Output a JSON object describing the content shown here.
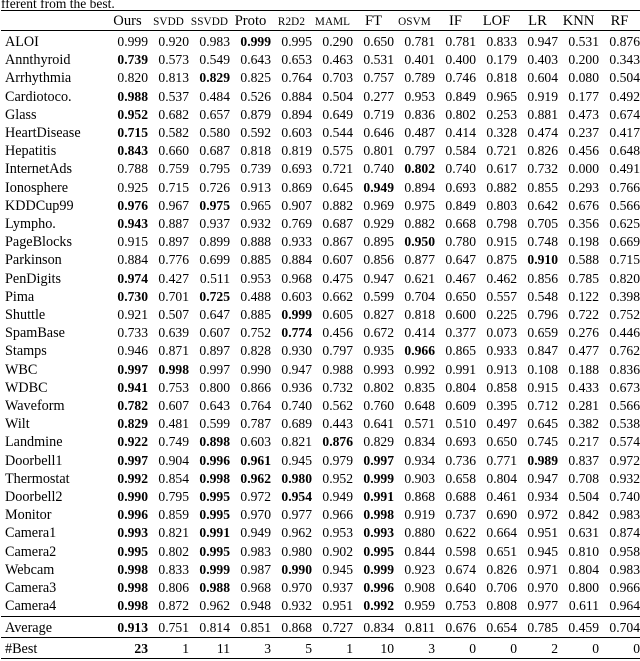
{
  "caption_tail": "fferent from the best.",
  "table": {
    "row_header_label": "",
    "columns": [
      "Ours",
      "SVDD",
      "SSVDD",
      "Proto",
      "R2D2",
      "MAML",
      "FT",
      "OSVM",
      "IF",
      "LOF",
      "LR",
      "KNN",
      "RF"
    ],
    "column_styles": [
      "reg",
      "sc",
      "sc",
      "reg",
      "sc",
      "sc",
      "reg",
      "sc",
      "reg",
      "reg",
      "reg",
      "reg",
      "reg"
    ],
    "rows": [
      {
        "name": "ALOI",
        "values": [
          "0.999",
          "0.920",
          "0.983",
          "0.999",
          "0.995",
          "0.290",
          "0.650",
          "0.781",
          "0.781",
          "0.833",
          "0.947",
          "0.531",
          "0.876"
        ],
        "bold": [
          3
        ]
      },
      {
        "name": "Annthyroid",
        "values": [
          "0.739",
          "0.573",
          "0.549",
          "0.643",
          "0.653",
          "0.463",
          "0.531",
          "0.401",
          "0.400",
          "0.179",
          "0.403",
          "0.200",
          "0.343"
        ],
        "bold": [
          0
        ]
      },
      {
        "name": "Arrhythmia",
        "values": [
          "0.820",
          "0.813",
          "0.829",
          "0.825",
          "0.764",
          "0.703",
          "0.757",
          "0.789",
          "0.746",
          "0.818",
          "0.604",
          "0.080",
          "0.504"
        ],
        "bold": [
          2
        ]
      },
      {
        "name": "Cardiotoco.",
        "values": [
          "0.988",
          "0.537",
          "0.484",
          "0.526",
          "0.884",
          "0.504",
          "0.277",
          "0.953",
          "0.849",
          "0.965",
          "0.919",
          "0.177",
          "0.492"
        ],
        "bold": [
          0
        ]
      },
      {
        "name": "Glass",
        "values": [
          "0.952",
          "0.682",
          "0.657",
          "0.879",
          "0.894",
          "0.649",
          "0.719",
          "0.836",
          "0.802",
          "0.253",
          "0.881",
          "0.473",
          "0.674"
        ],
        "bold": [
          0
        ]
      },
      {
        "name": "HeartDisease",
        "values": [
          "0.715",
          "0.582",
          "0.580",
          "0.592",
          "0.603",
          "0.544",
          "0.646",
          "0.487",
          "0.414",
          "0.328",
          "0.474",
          "0.237",
          "0.417"
        ],
        "bold": [
          0
        ]
      },
      {
        "name": "Hepatitis",
        "values": [
          "0.843",
          "0.660",
          "0.687",
          "0.818",
          "0.819",
          "0.575",
          "0.801",
          "0.797",
          "0.584",
          "0.721",
          "0.826",
          "0.456",
          "0.648"
        ],
        "bold": [
          0
        ]
      },
      {
        "name": "InternetAds",
        "values": [
          "0.788",
          "0.759",
          "0.795",
          "0.739",
          "0.693",
          "0.721",
          "0.740",
          "0.802",
          "0.740",
          "0.617",
          "0.732",
          "0.000",
          "0.491"
        ],
        "bold": [
          7
        ]
      },
      {
        "name": "Ionosphere",
        "values": [
          "0.925",
          "0.715",
          "0.726",
          "0.913",
          "0.869",
          "0.645",
          "0.949",
          "0.894",
          "0.693",
          "0.882",
          "0.855",
          "0.293",
          "0.766"
        ],
        "bold": [
          6
        ]
      },
      {
        "name": "KDDCup99",
        "values": [
          "0.976",
          "0.967",
          "0.975",
          "0.965",
          "0.907",
          "0.882",
          "0.969",
          "0.975",
          "0.849",
          "0.803",
          "0.642",
          "0.676",
          "0.566"
        ],
        "bold": [
          0,
          2
        ]
      },
      {
        "name": "Lympho.",
        "values": [
          "0.943",
          "0.887",
          "0.937",
          "0.932",
          "0.769",
          "0.687",
          "0.929",
          "0.882",
          "0.668",
          "0.798",
          "0.705",
          "0.356",
          "0.625"
        ],
        "bold": [
          0
        ]
      },
      {
        "name": "PageBlocks",
        "values": [
          "0.915",
          "0.897",
          "0.899",
          "0.888",
          "0.933",
          "0.867",
          "0.895",
          "0.950",
          "0.780",
          "0.915",
          "0.748",
          "0.198",
          "0.669"
        ],
        "bold": [
          7
        ]
      },
      {
        "name": "Parkinson",
        "values": [
          "0.884",
          "0.776",
          "0.699",
          "0.885",
          "0.884",
          "0.607",
          "0.856",
          "0.877",
          "0.647",
          "0.875",
          "0.910",
          "0.588",
          "0.715"
        ],
        "bold": [
          10
        ]
      },
      {
        "name": "PenDigits",
        "values": [
          "0.974",
          "0.427",
          "0.511",
          "0.953",
          "0.968",
          "0.475",
          "0.947",
          "0.621",
          "0.467",
          "0.462",
          "0.856",
          "0.785",
          "0.820"
        ],
        "bold": [
          0
        ]
      },
      {
        "name": "Pima",
        "values": [
          "0.730",
          "0.701",
          "0.725",
          "0.488",
          "0.603",
          "0.662",
          "0.599",
          "0.704",
          "0.650",
          "0.557",
          "0.548",
          "0.122",
          "0.398"
        ],
        "bold": [
          0,
          2
        ]
      },
      {
        "name": "Shuttle",
        "values": [
          "0.921",
          "0.507",
          "0.647",
          "0.885",
          "0.999",
          "0.605",
          "0.827",
          "0.818",
          "0.600",
          "0.225",
          "0.796",
          "0.722",
          "0.752"
        ],
        "bold": [
          4
        ]
      },
      {
        "name": "SpamBase",
        "values": [
          "0.733",
          "0.639",
          "0.607",
          "0.752",
          "0.774",
          "0.456",
          "0.672",
          "0.414",
          "0.377",
          "0.073",
          "0.659",
          "0.276",
          "0.446"
        ],
        "bold": [
          4
        ]
      },
      {
        "name": "Stamps",
        "values": [
          "0.946",
          "0.871",
          "0.897",
          "0.828",
          "0.930",
          "0.797",
          "0.935",
          "0.966",
          "0.865",
          "0.933",
          "0.847",
          "0.477",
          "0.762"
        ],
        "bold": [
          7
        ]
      },
      {
        "name": "WBC",
        "values": [
          "0.997",
          "0.998",
          "0.997",
          "0.990",
          "0.947",
          "0.988",
          "0.993",
          "0.992",
          "0.991",
          "0.913",
          "0.108",
          "0.188",
          "0.836"
        ],
        "bold": [
          0,
          1
        ]
      },
      {
        "name": "WDBC",
        "values": [
          "0.941",
          "0.753",
          "0.800",
          "0.866",
          "0.936",
          "0.732",
          "0.802",
          "0.835",
          "0.804",
          "0.858",
          "0.915",
          "0.433",
          "0.673"
        ],
        "bold": [
          0
        ]
      },
      {
        "name": "Waveform",
        "values": [
          "0.782",
          "0.607",
          "0.643",
          "0.764",
          "0.740",
          "0.562",
          "0.760",
          "0.648",
          "0.609",
          "0.395",
          "0.712",
          "0.281",
          "0.566"
        ],
        "bold": [
          0
        ]
      },
      {
        "name": "Wilt",
        "values": [
          "0.829",
          "0.481",
          "0.599",
          "0.787",
          "0.689",
          "0.443",
          "0.641",
          "0.571",
          "0.510",
          "0.497",
          "0.645",
          "0.382",
          "0.538"
        ],
        "bold": [
          0
        ]
      },
      {
        "name": "Landmine",
        "values": [
          "0.922",
          "0.749",
          "0.898",
          "0.603",
          "0.821",
          "0.876",
          "0.829",
          "0.834",
          "0.693",
          "0.650",
          "0.745",
          "0.217",
          "0.574"
        ],
        "bold": [
          0,
          2,
          5
        ]
      },
      {
        "name": "Doorbell1",
        "values": [
          "0.997",
          "0.904",
          "0.996",
          "0.961",
          "0.945",
          "0.979",
          "0.997",
          "0.934",
          "0.736",
          "0.771",
          "0.989",
          "0.837",
          "0.972"
        ],
        "bold": [
          0,
          2,
          3,
          6,
          10
        ]
      },
      {
        "name": "Thermostat",
        "values": [
          "0.992",
          "0.854",
          "0.998",
          "0.962",
          "0.980",
          "0.952",
          "0.999",
          "0.903",
          "0.658",
          "0.804",
          "0.947",
          "0.708",
          "0.932"
        ],
        "bold": [
          0,
          2,
          3,
          4,
          6
        ]
      },
      {
        "name": "Doorbell2",
        "values": [
          "0.990",
          "0.795",
          "0.995",
          "0.972",
          "0.954",
          "0.949",
          "0.991",
          "0.868",
          "0.688",
          "0.461",
          "0.934",
          "0.504",
          "0.740"
        ],
        "bold": [
          0,
          2,
          4,
          6
        ]
      },
      {
        "name": "Monitor",
        "values": [
          "0.996",
          "0.859",
          "0.995",
          "0.970",
          "0.977",
          "0.966",
          "0.998",
          "0.919",
          "0.737",
          "0.690",
          "0.972",
          "0.842",
          "0.983"
        ],
        "bold": [
          0,
          2,
          6
        ]
      },
      {
        "name": "Camera1",
        "values": [
          "0.993",
          "0.821",
          "0.991",
          "0.949",
          "0.962",
          "0.953",
          "0.993",
          "0.880",
          "0.622",
          "0.664",
          "0.951",
          "0.631",
          "0.874"
        ],
        "bold": [
          0,
          2,
          6
        ]
      },
      {
        "name": "Camera2",
        "values": [
          "0.995",
          "0.802",
          "0.995",
          "0.983",
          "0.980",
          "0.902",
          "0.995",
          "0.844",
          "0.598",
          "0.651",
          "0.945",
          "0.810",
          "0.958"
        ],
        "bold": [
          0,
          2,
          6
        ]
      },
      {
        "name": "Webcam",
        "values": [
          "0.998",
          "0.833",
          "0.999",
          "0.987",
          "0.990",
          "0.945",
          "0.999",
          "0.923",
          "0.674",
          "0.826",
          "0.971",
          "0.804",
          "0.983"
        ],
        "bold": [
          0,
          2,
          4,
          6
        ]
      },
      {
        "name": "Camera3",
        "values": [
          "0.998",
          "0.806",
          "0.988",
          "0.968",
          "0.970",
          "0.937",
          "0.996",
          "0.908",
          "0.640",
          "0.706",
          "0.970",
          "0.800",
          "0.966"
        ],
        "bold": [
          0,
          2,
          6
        ]
      },
      {
        "name": "Camera4",
        "values": [
          "0.998",
          "0.872",
          "0.962",
          "0.948",
          "0.932",
          "0.951",
          "0.992",
          "0.959",
          "0.753",
          "0.808",
          "0.977",
          "0.611",
          "0.964"
        ],
        "bold": [
          0,
          6
        ]
      }
    ],
    "summary_rows": [
      {
        "name": "Average",
        "values": [
          "0.913",
          "0.751",
          "0.814",
          "0.851",
          "0.868",
          "0.727",
          "0.834",
          "0.811",
          "0.676",
          "0.654",
          "0.785",
          "0.459",
          "0.704"
        ],
        "bold": [
          0
        ]
      },
      {
        "name": "#Best",
        "values": [
          "23",
          "1",
          "11",
          "3",
          "5",
          "1",
          "10",
          "3",
          "0",
          "0",
          "2",
          "0",
          "0"
        ],
        "bold": [
          0
        ]
      }
    ]
  }
}
